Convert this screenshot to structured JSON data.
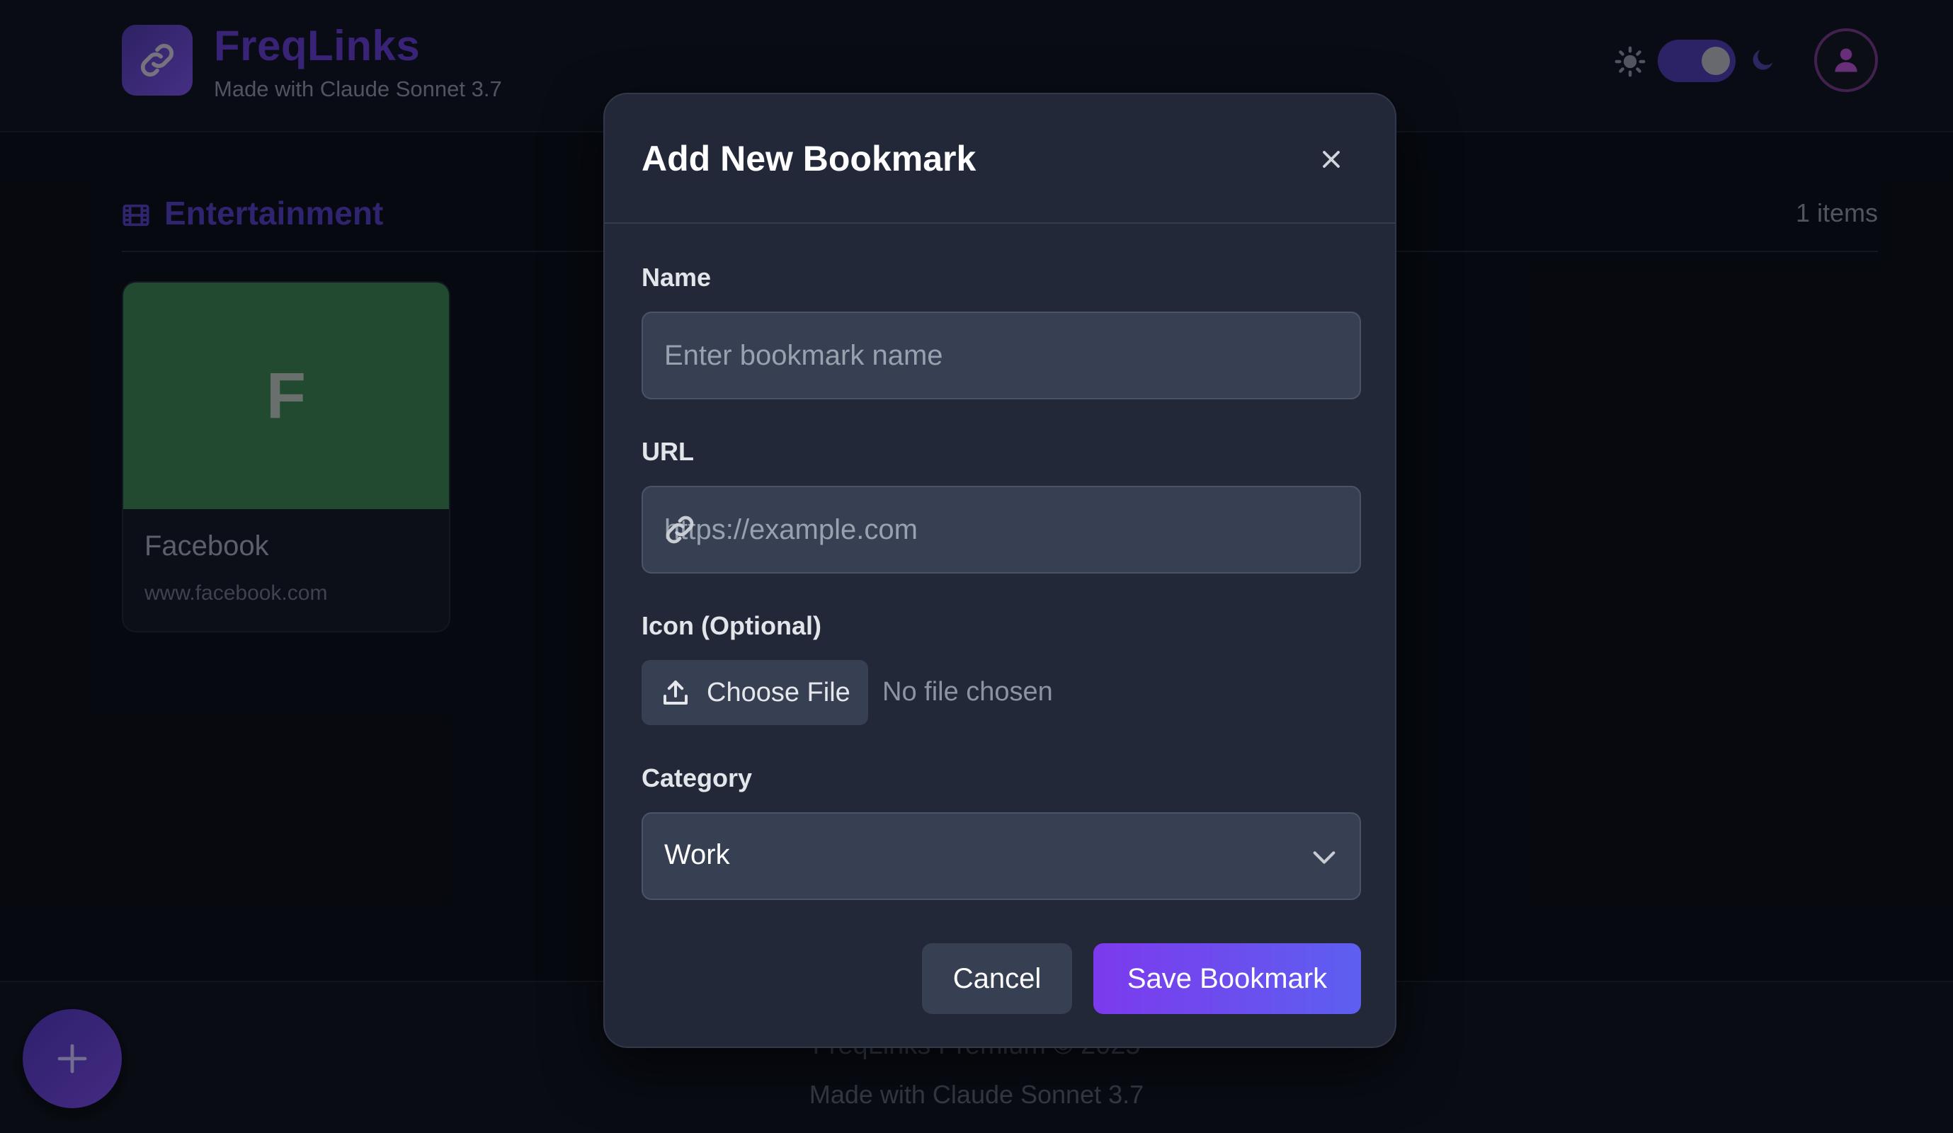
{
  "header": {
    "brand_title": "FreqLinks",
    "brand_subtitle": "Made with Claude Sonnet 3.7",
    "logo_icon": "link-icon",
    "theme_toggle": {
      "state": "dark",
      "sun_icon": "sun-icon",
      "moon_icon": "moon-icon"
    },
    "avatar_icon": "user-icon"
  },
  "section": {
    "icon": "film-icon",
    "title": "Entertainment",
    "count": "1 items",
    "cards": [
      {
        "letter": "F",
        "name": "Facebook",
        "url": "www.facebook.com",
        "color": "#2d6341"
      }
    ]
  },
  "footer": {
    "line1": "FreqLinks Premium © 2025",
    "line2": "Made with Claude Sonnet 3.7"
  },
  "fab": {
    "icon": "plus-icon"
  },
  "modal": {
    "title": "Add New Bookmark",
    "close_icon": "close-icon",
    "name_label": "Name",
    "name_placeholder": "Enter bookmark name",
    "name_value": "",
    "url_label": "URL",
    "url_placeholder": "https://example.com",
    "url_value": "",
    "icon_label": "Icon (Optional)",
    "file_button_label": "Choose File",
    "file_status": "No file chosen",
    "category_label": "Category",
    "category_value": "Work",
    "cancel_label": "Cancel",
    "save_label": "Save Bookmark"
  },
  "colors": {
    "accent": "#7c3aed",
    "accent_end": "#5d5ff0",
    "background": "#090c14",
    "modal_bg": "#222838"
  }
}
